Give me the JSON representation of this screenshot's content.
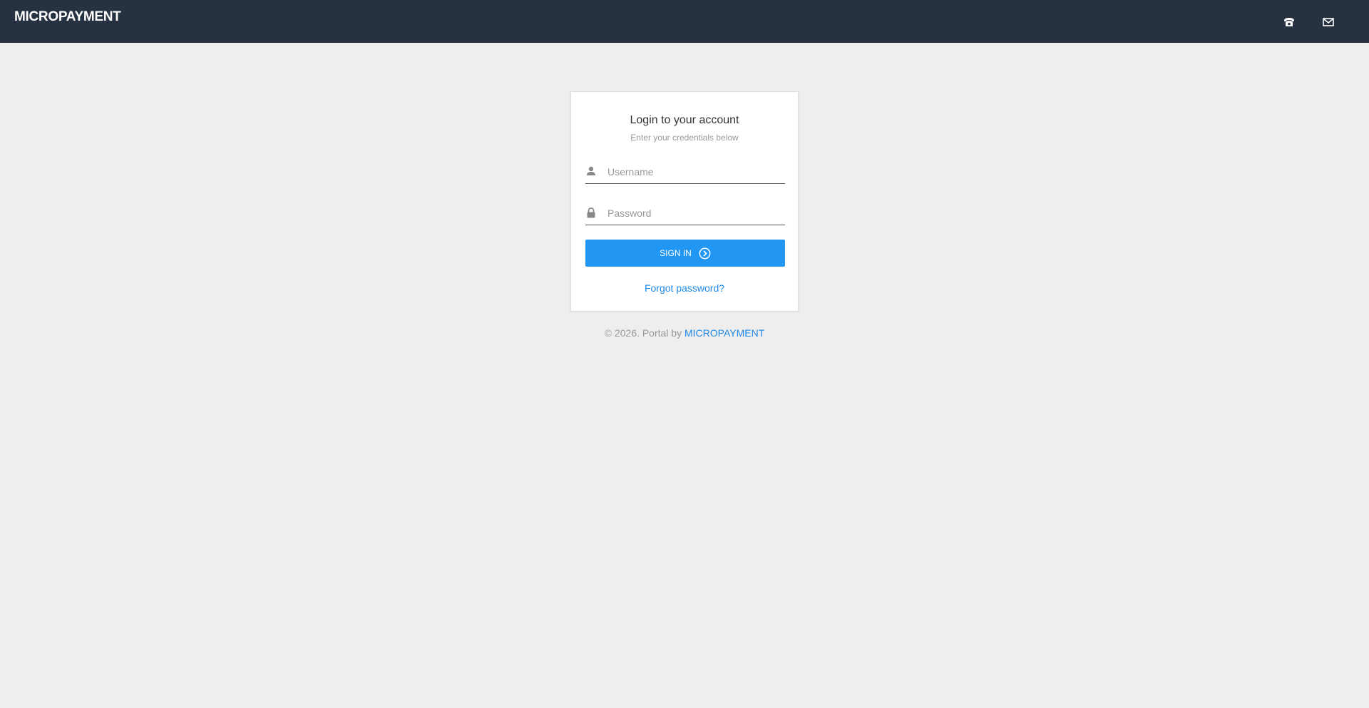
{
  "navbar": {
    "brand": "MICROPAYMENT",
    "icons": [
      "phone-icon",
      "mail-icon"
    ]
  },
  "login": {
    "title": "Login to your account",
    "subtitle": "Enter your credentials below",
    "username": {
      "value": "",
      "placeholder": "Username",
      "icon": "user-icon"
    },
    "password": {
      "value": "",
      "placeholder": "Password",
      "icon": "lock-icon"
    },
    "signin_label": "SIGN IN",
    "signin_icon": "circle-arrow-right-icon",
    "forgot_label": "Forgot password?"
  },
  "footer": {
    "text": "© 2026. Portal by",
    "link": "MICROPAYMENT"
  },
  "colors": {
    "navbar": "#263142",
    "background": "#eeeeee",
    "accent": "#2196f3",
    "link": "#1e88e5"
  }
}
